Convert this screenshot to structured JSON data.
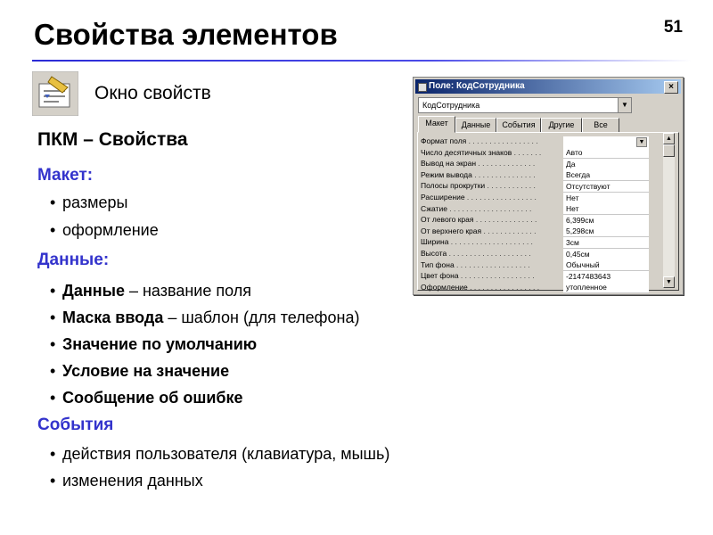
{
  "slide": {
    "title": "Свойства элементов",
    "page_number": "51",
    "subtitle": "Окно свойств",
    "pkm": "ПКМ – Свойства",
    "accent_color": "#3333cc"
  },
  "sections": {
    "maket": {
      "heading": "Макет:",
      "items": [
        "размеры",
        "оформление"
      ]
    },
    "dannye": {
      "heading": "Данные:",
      "items": [
        {
          "bold": "Данные",
          "rest": " – название поля"
        },
        {
          "bold": "Маска ввода",
          "rest": " – шаблон (для телефона)"
        },
        {
          "bold": "Значение по умолчанию",
          "rest": ""
        },
        {
          "bold": "Условие на значение",
          "rest": ""
        },
        {
          "bold": "Сообщение об ошибке",
          "rest": ""
        }
      ]
    },
    "sobytiya": {
      "heading": "События",
      "items": [
        "действия пользователя (клавиатура, мышь)",
        "изменения данных"
      ]
    }
  },
  "dialog": {
    "title": "Поле: КодСотрудника",
    "close": "×",
    "combo_value": "КодСотрудника",
    "tabs": [
      "Макет",
      "Данные",
      "События",
      "Другие",
      "Все"
    ],
    "active_tab": "Макет",
    "props": [
      {
        "name": "Формат поля",
        "dots": " . . . . . . . . . . . . . . . . .",
        "value": ""
      },
      {
        "name": "Число десятичных знаков",
        "dots": " . . . . . . .",
        "value": "Авто"
      },
      {
        "name": "Вывод на экран",
        "dots": " . . . . . . . . . . . . . .",
        "value": "Да"
      },
      {
        "name": "Режим вывода",
        "dots": " . . . . . . . . . . . . . . .",
        "value": "Всегда"
      },
      {
        "name": "Полосы прокрутки",
        "dots": " . . . . . . . . . . . .",
        "value": "Отсутствуют"
      },
      {
        "name": "Расширение",
        "dots": " . . . . . . . . . . . . . . . . .",
        "value": "Нет"
      },
      {
        "name": "Сжатие",
        "dots": " . . . . . . . . . . . . . . . . . . . .",
        "value": "Нет"
      },
      {
        "name": "От левого края",
        "dots": " . . . . . . . . . . . . . . .",
        "value": "6,399см"
      },
      {
        "name": "От верхнего края",
        "dots": " . . . . . . . . . . . . .",
        "value": "5,298см"
      },
      {
        "name": "Ширина",
        "dots": " . . . . . . . . . . . . . . . . . . . .",
        "value": "3см"
      },
      {
        "name": "Высота",
        "dots": " . . . . . . . . . . . . . . . . . . . .",
        "value": "0,45см"
      },
      {
        "name": "Тип фона",
        "dots": " . . . . . . . . . . . . . . . . . .",
        "value": "Обычный"
      },
      {
        "name": "Цвет фона",
        "dots": " . . . . . . . . . . . . . . . . . .",
        "value": "-2147483643"
      },
      {
        "name": "Оформление",
        "dots": " . . . . . . . . . . . . . . . . .",
        "value": "утопленное"
      }
    ]
  }
}
